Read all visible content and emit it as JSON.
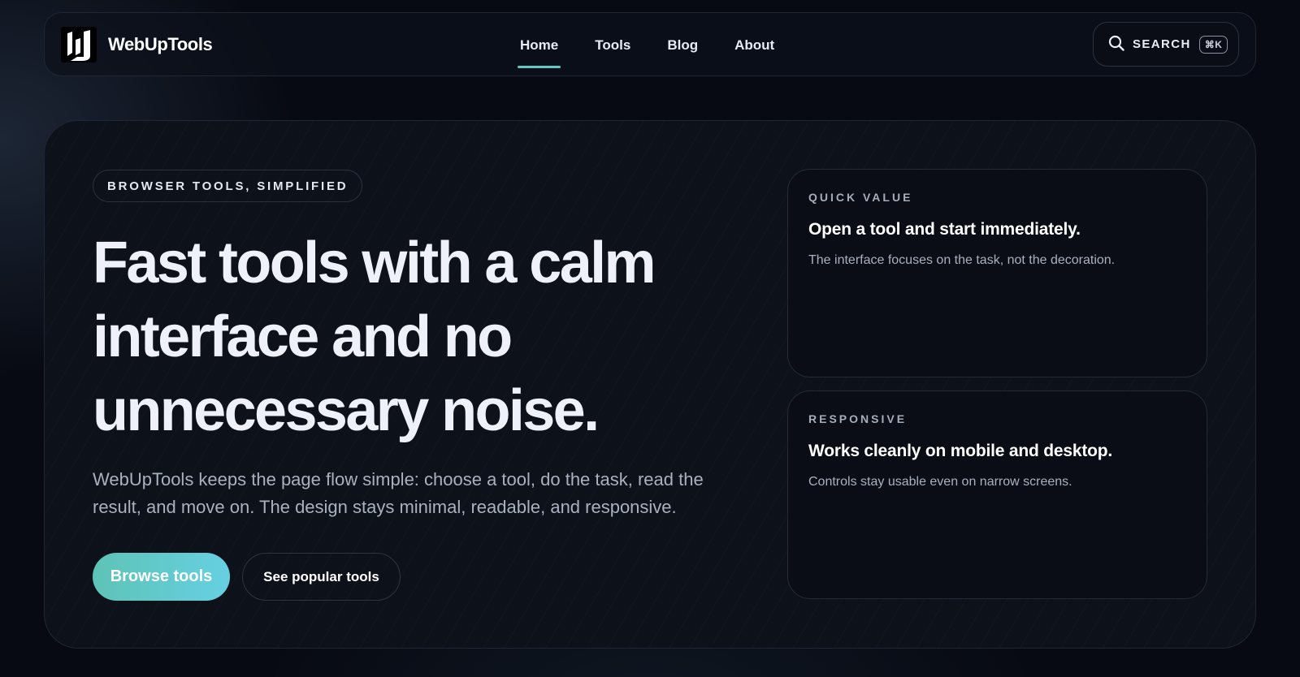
{
  "brand": {
    "name": "WebUpTools",
    "logo_letter": "U"
  },
  "nav": {
    "items": [
      {
        "label": "Home",
        "active": true
      },
      {
        "label": "Tools",
        "active": false
      },
      {
        "label": "Blog",
        "active": false
      },
      {
        "label": "About",
        "active": false
      }
    ]
  },
  "search": {
    "label": "SEARCH",
    "shortcut": "⌘K",
    "icon": "search-icon"
  },
  "hero": {
    "eyebrow": "BROWSER TOOLS, SIMPLIFIED",
    "title": "Fast tools with a calm interface and no unnecessary noise.",
    "description": "WebUpTools keeps the page flow simple: choose a tool, do the task, read the result, and move on. The design stays minimal, readable, and responsive.",
    "primary_button": "Browse tools",
    "secondary_button": "See popular tools"
  },
  "cards": [
    {
      "kicker": "QUICK VALUE",
      "title": "Open a tool and start immediately.",
      "text": "The interface focuses on the task, not the decoration."
    },
    {
      "kicker": "RESPONSIVE",
      "title": "Works cleanly on mobile and desktop.",
      "text": "Controls stay usable even on narrow screens."
    }
  ],
  "colors": {
    "accent": "#5cc9c4",
    "primary_gradient_start": "#5ec3b6",
    "primary_gradient_end": "#66d0e2",
    "background": "#070a12"
  }
}
